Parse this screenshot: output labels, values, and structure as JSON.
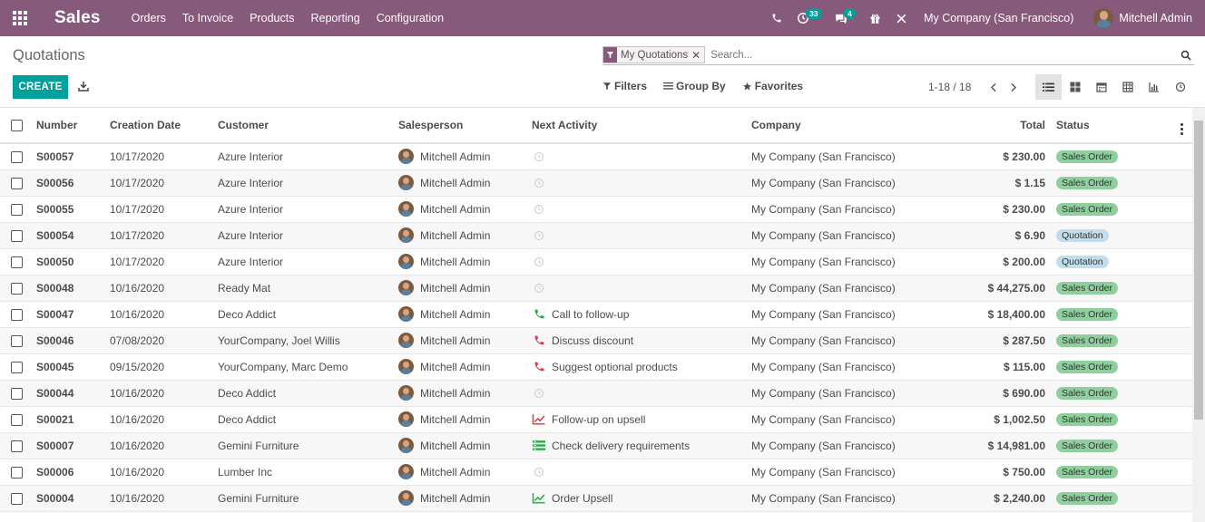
{
  "navbar": {
    "brand": "Sales",
    "menu": [
      "Orders",
      "To Invoice",
      "Products",
      "Reporting",
      "Configuration"
    ],
    "activity_count": "33",
    "message_count": "4",
    "company": "My Company (San Francisco)",
    "user": "Mitchell Admin",
    "colors": {
      "brand": "#875a7b",
      "accent": "#00a09d"
    }
  },
  "control_panel": {
    "title": "Quotations",
    "create_label": "CREATE",
    "facet_label": "My Quotations",
    "search_placeholder": "Search...",
    "filters_label": "Filters",
    "groupby_label": "Group By",
    "favorites_label": "Favorites",
    "pager": "1-18 / 18"
  },
  "table": {
    "headers": {
      "number": "Number",
      "creation_date": "Creation Date",
      "customer": "Customer",
      "salesperson": "Salesperson",
      "next_activity": "Next Activity",
      "company": "Company",
      "total": "Total",
      "status": "Status"
    },
    "rows": [
      {
        "number": "S00057",
        "date": "10/17/2020",
        "customer": "Azure Interior",
        "salesperson": "Mitchell Admin",
        "activity": "",
        "activity_icon": "clock-icon",
        "company": "My Company (San Francisco)",
        "total": "$ 230.00",
        "status": "Sales Order"
      },
      {
        "number": "S00056",
        "date": "10/17/2020",
        "customer": "Azure Interior",
        "salesperson": "Mitchell Admin",
        "activity": "",
        "activity_icon": "clock-icon",
        "company": "My Company (San Francisco)",
        "total": "$ 1.15",
        "status": "Sales Order"
      },
      {
        "number": "S00055",
        "date": "10/17/2020",
        "customer": "Azure Interior",
        "salesperson": "Mitchell Admin",
        "activity": "",
        "activity_icon": "clock-icon",
        "company": "My Company (San Francisco)",
        "total": "$ 230.00",
        "status": "Sales Order"
      },
      {
        "number": "S00054",
        "date": "10/17/2020",
        "customer": "Azure Interior",
        "salesperson": "Mitchell Admin",
        "activity": "",
        "activity_icon": "clock-icon",
        "company": "My Company (San Francisco)",
        "total": "$ 6.90",
        "status": "Quotation"
      },
      {
        "number": "S00050",
        "date": "10/17/2020",
        "customer": "Azure Interior",
        "salesperson": "Mitchell Admin",
        "activity": "",
        "activity_icon": "clock-icon",
        "company": "My Company (San Francisco)",
        "total": "$ 200.00",
        "status": "Quotation"
      },
      {
        "number": "S00048",
        "date": "10/16/2020",
        "customer": "Ready Mat",
        "salesperson": "Mitchell Admin",
        "activity": "",
        "activity_icon": "clock-icon",
        "company": "My Company (San Francisco)",
        "total": "$ 44,275.00",
        "status": "Sales Order"
      },
      {
        "number": "S00047",
        "date": "10/16/2020",
        "customer": "Deco Addict",
        "salesperson": "Mitchell Admin",
        "activity": "Call to follow-up",
        "activity_icon": "phone-icon-green",
        "company": "My Company (San Francisco)",
        "total": "$ 18,400.00",
        "status": "Sales Order"
      },
      {
        "number": "S00046",
        "date": "07/08/2020",
        "customer": "YourCompany, Joel Willis",
        "salesperson": "Mitchell Admin",
        "activity": "Discuss discount",
        "activity_icon": "phone-icon-red",
        "company": "My Company (San Francisco)",
        "total": "$ 287.50",
        "status": "Sales Order"
      },
      {
        "number": "S00045",
        "date": "09/15/2020",
        "customer": "YourCompany, Marc Demo",
        "salesperson": "Mitchell Admin",
        "activity": "Suggest optional products",
        "activity_icon": "phone-icon-red",
        "company": "My Company (San Francisco)",
        "total": "$ 115.00",
        "status": "Sales Order"
      },
      {
        "number": "S00044",
        "date": "10/16/2020",
        "customer": "Deco Addict",
        "salesperson": "Mitchell Admin",
        "activity": "",
        "activity_icon": "clock-icon",
        "company": "My Company (San Francisco)",
        "total": "$ 690.00",
        "status": "Sales Order"
      },
      {
        "number": "S00021",
        "date": "10/16/2020",
        "customer": "Deco Addict",
        "salesperson": "Mitchell Admin",
        "activity": "Follow-up on upsell",
        "activity_icon": "chart-line-icon-red",
        "company": "My Company (San Francisco)",
        "total": "$ 1,002.50",
        "status": "Sales Order"
      },
      {
        "number": "S00007",
        "date": "10/16/2020",
        "customer": "Gemini Furniture",
        "salesperson": "Mitchell Admin",
        "activity": "Check delivery requirements",
        "activity_icon": "tasks-icon-green",
        "company": "My Company (San Francisco)",
        "total": "$ 14,981.00",
        "status": "Sales Order"
      },
      {
        "number": "S00006",
        "date": "10/16/2020",
        "customer": "Lumber Inc",
        "salesperson": "Mitchell Admin",
        "activity": "",
        "activity_icon": "clock-icon",
        "company": "My Company (San Francisco)",
        "total": "$ 750.00",
        "status": "Sales Order"
      },
      {
        "number": "S00004",
        "date": "10/16/2020",
        "customer": "Gemini Furniture",
        "salesperson": "Mitchell Admin",
        "activity": "Order Upsell",
        "activity_icon": "chart-line-icon-green",
        "company": "My Company (San Francisco)",
        "total": "$ 2,240.00",
        "status": "Sales Order"
      }
    ]
  }
}
